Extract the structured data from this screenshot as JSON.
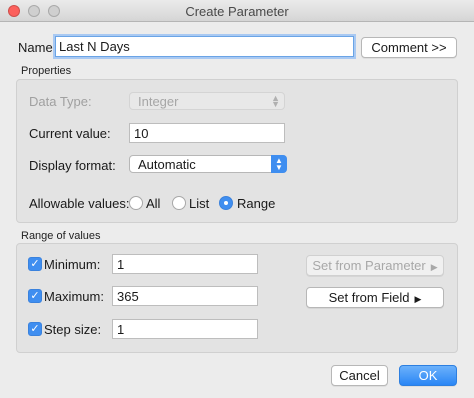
{
  "window": {
    "title": "Create Parameter"
  },
  "name": {
    "label": "Name:",
    "value": "Last N Days"
  },
  "comment_button": "Comment >>",
  "properties": {
    "title": "Properties",
    "data_type_label": "Data Type:",
    "data_type_value": "Integer",
    "current_value_label": "Current value:",
    "current_value": "10",
    "display_format_label": "Display format:",
    "display_format_value": "Automatic",
    "allowable_values_label": "Allowable values:",
    "allowable_options": [
      "All",
      "List",
      "Range"
    ],
    "allowable_selected": "Range"
  },
  "range": {
    "title": "Range of values",
    "minimum_label": "Minimum:",
    "minimum_value": "1",
    "minimum_checked": true,
    "maximum_label": "Maximum:",
    "maximum_value": "365",
    "maximum_checked": true,
    "step_label": "Step size:",
    "step_value": "1",
    "step_checked": true,
    "set_from_parameter": "Set from Parameter",
    "set_from_field": "Set from Field"
  },
  "footer": {
    "cancel": "Cancel",
    "ok": "OK"
  },
  "colors": {
    "accent": "#3f8ef0",
    "close": "#fc605c"
  }
}
